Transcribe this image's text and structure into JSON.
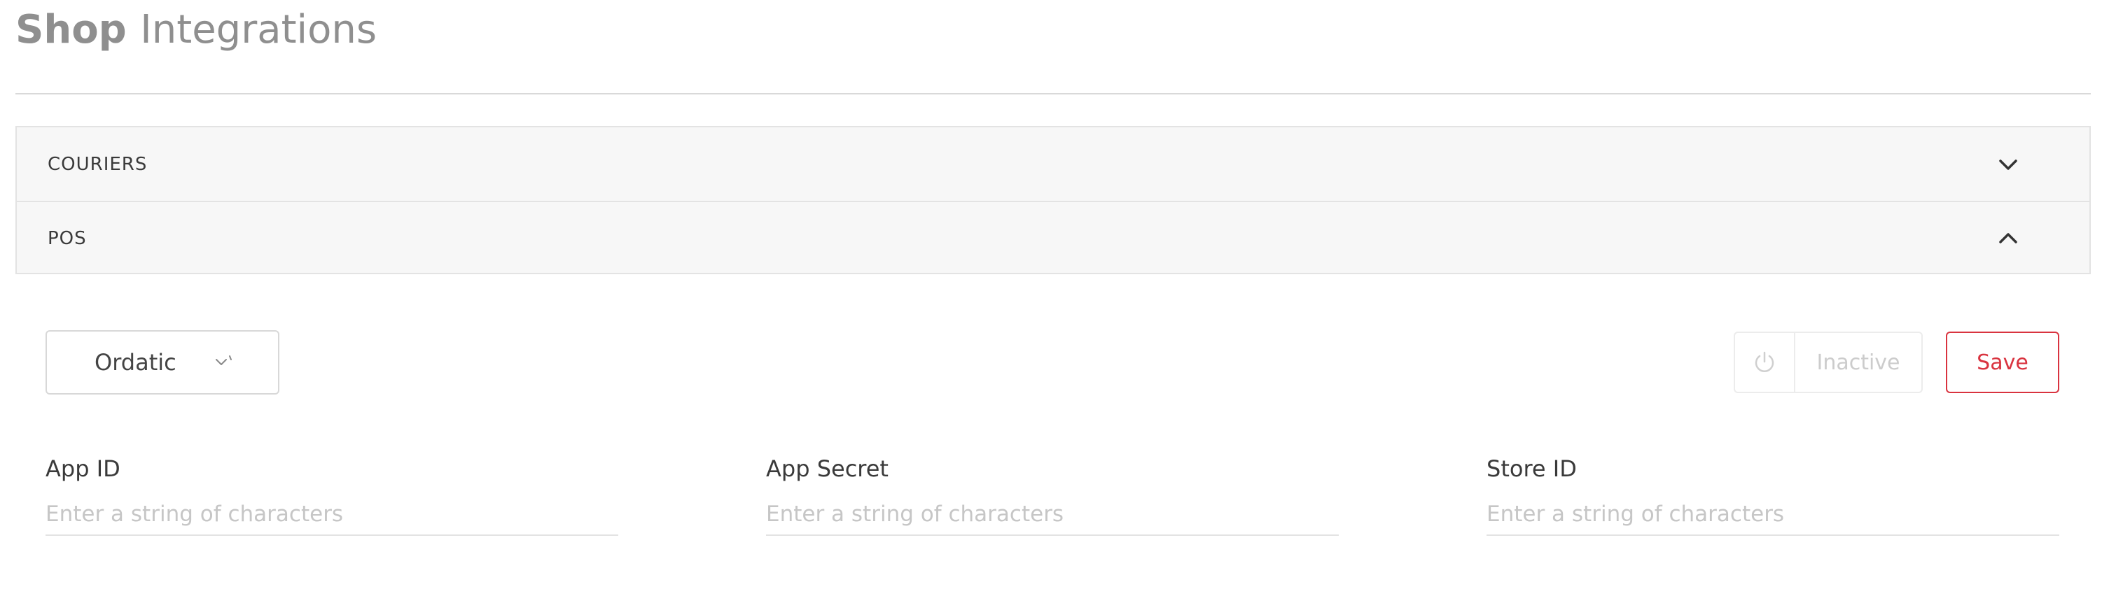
{
  "header": {
    "title_bold": "Shop",
    "title_light": "Integrations"
  },
  "accordion": {
    "items": [
      {
        "label": "COURIERS",
        "expanded": false,
        "icon": "chevron-down-icon"
      },
      {
        "label": "POS",
        "expanded": true,
        "icon": "chevron-up-icon"
      }
    ]
  },
  "pos_panel": {
    "provider_select": {
      "value": "Ordatic",
      "icon": "caret-down-icon"
    },
    "status": {
      "label": "Inactive",
      "icon": "power-icon"
    },
    "save_label": "Save",
    "fields": [
      {
        "label": "App ID",
        "placeholder": "Enter a string of characters",
        "value": ""
      },
      {
        "label": "App Secret",
        "placeholder": "Enter a string of characters",
        "value": ""
      },
      {
        "label": "Store ID",
        "placeholder": "Enter a string of characters",
        "value": ""
      }
    ]
  },
  "colors": {
    "accent": "#d9333f",
    "panel_background": "#f7f7f7",
    "border": "#e3e3e3",
    "title_text": "#8f8f8f",
    "placeholder": "#c6c6c6",
    "inactive_text": "#cccccc"
  }
}
